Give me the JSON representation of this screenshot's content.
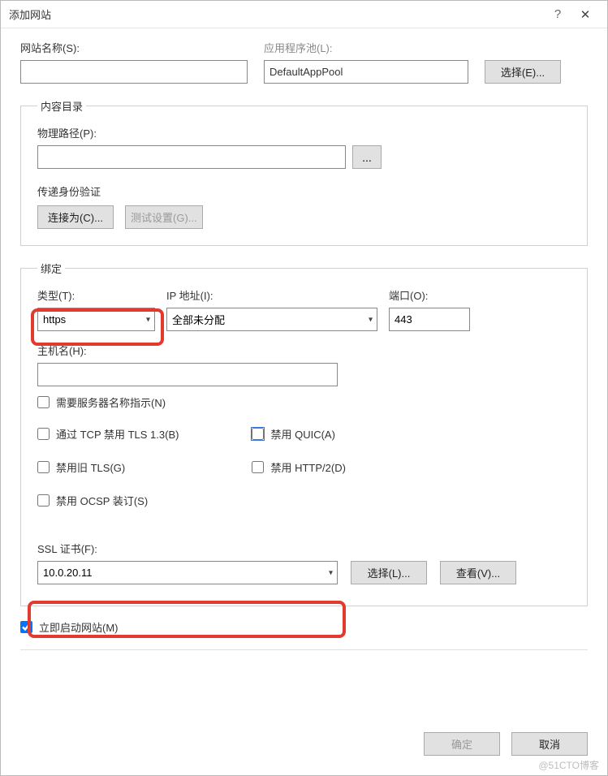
{
  "window": {
    "title": "添加网站",
    "help_glyph": "?",
    "close_glyph": "✕"
  },
  "site": {
    "name_label": "网站名称(S):",
    "name_value": "",
    "pool_label": "应用程序池(L):",
    "pool_value": "DefaultAppPool",
    "select_btn": "选择(E)..."
  },
  "content_dir": {
    "legend": "内容目录",
    "phys_path_label": "物理路径(P):",
    "phys_path_value": "",
    "browse_glyph": "...",
    "auth_label": "传递身份验证",
    "connect_as_btn": "连接为(C)...",
    "test_btn": "测试设置(G)..."
  },
  "binding": {
    "legend": "绑定",
    "type_label": "类型(T):",
    "type_value": "https",
    "ip_label": "IP 地址(I):",
    "ip_value": "全部未分配",
    "port_label": "端口(O):",
    "port_value": "443",
    "host_label": "主机名(H):",
    "host_value": "",
    "sni_label": "需要服务器名称指示(N)",
    "disable_tls13": "通过 TCP 禁用 TLS 1.3(B)",
    "disable_quic": "禁用 QUIC(A)",
    "disable_old_tls": "禁用旧 TLS(G)",
    "disable_http2": "禁用 HTTP/2(D)",
    "disable_ocsp": "禁用 OCSP 装订(S)",
    "ssl_cert_label": "SSL 证书(F):",
    "ssl_cert_value": "10.0.20.11",
    "ssl_select_btn": "选择(L)...",
    "ssl_view_btn": "查看(V)..."
  },
  "start_immediate": "立即启动网站(M)",
  "ok_btn": "确定",
  "cancel_btn": "取消",
  "watermark": "@51CTO博客"
}
